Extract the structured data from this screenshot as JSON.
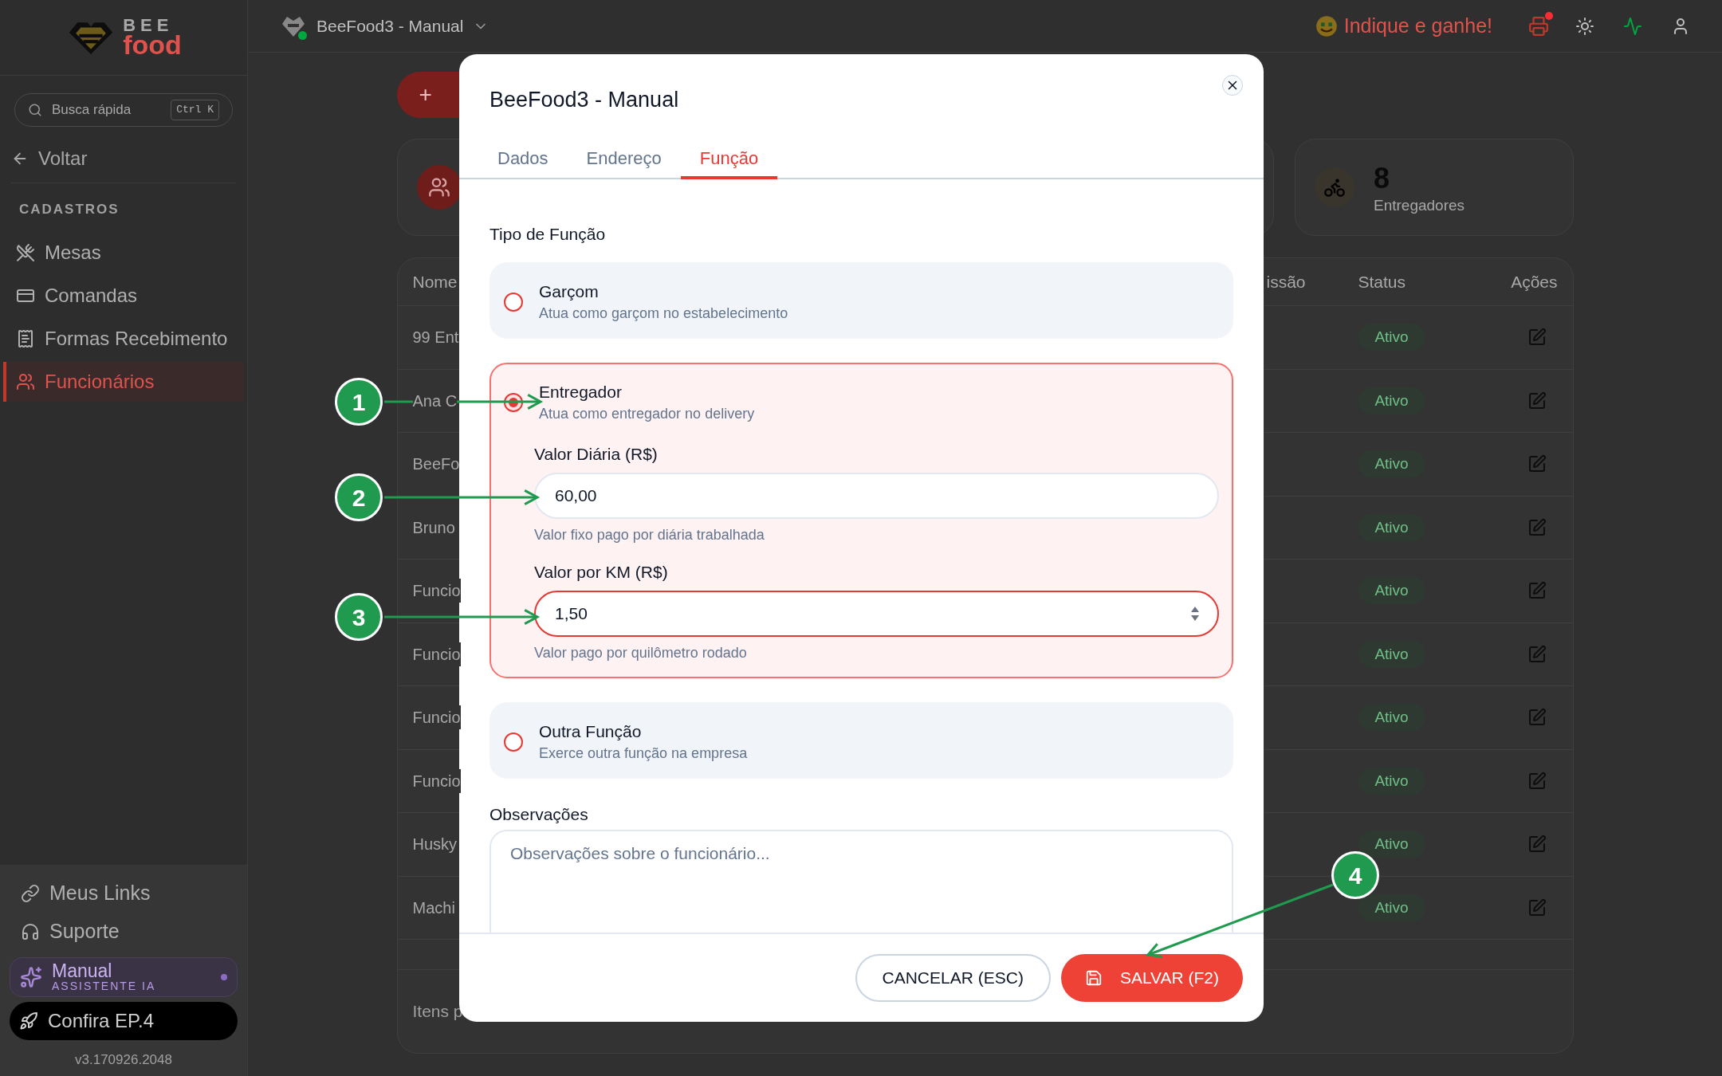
{
  "sidebar": {
    "logo_top": "BEE",
    "logo_bottom": "food",
    "search": {
      "placeholder": "Busca rápida",
      "shortcut": "Ctrl K"
    },
    "back": "Voltar",
    "section": "CADASTROS",
    "items": [
      {
        "label": "Mesas",
        "selected": false
      },
      {
        "label": "Comandas",
        "selected": false
      },
      {
        "label": "Formas Recebimento",
        "selected": false
      },
      {
        "label": "Funcionários",
        "selected": true
      }
    ],
    "footer_links": [
      "Meus Links",
      "Suporte"
    ],
    "assistant": {
      "title": "Manual",
      "subtitle": "ASSISTENTE IA"
    },
    "promo": "Confira EP.4",
    "version": "v3.170926.2048"
  },
  "topbar": {
    "workspace": "BeeFood3 - Manual",
    "referral": "Indique e ganhe!",
    "printer_alert": true
  },
  "page": {
    "add_button": "+",
    "stat_cards": [
      {
        "value": "8",
        "label": "Entregadores"
      }
    ],
    "table": {
      "columns": [
        "Nome",
        "issão",
        "Status",
        "Ações"
      ],
      "rows": [
        {
          "name": "99 Ent",
          "status": "Ativo"
        },
        {
          "name": "Ana C",
          "status": "Ativo"
        },
        {
          "name": "BeeFo",
          "status": "Ativo"
        },
        {
          "name": "Bruno",
          "status": "Ativo"
        },
        {
          "name": "Funcio",
          "status": "Ativo"
        },
        {
          "name": "Funcio",
          "status": "Ativo"
        },
        {
          "name": "Funcio",
          "status": "Ativo"
        },
        {
          "name": "Funcio",
          "status": "Ativo"
        },
        {
          "name": "Husky",
          "status": "Ativo"
        },
        {
          "name": "Machi",
          "status": "Ativo"
        }
      ]
    },
    "pagination": "Itens p"
  },
  "modal": {
    "title": "BeeFood3 - Manual",
    "tabs": [
      {
        "label": "Dados",
        "selected": false
      },
      {
        "label": "Endereço",
        "selected": false
      },
      {
        "label": "Função",
        "selected": true
      }
    ],
    "section_label": "Tipo de Função",
    "options": [
      {
        "title": "Garçom",
        "description": "Atua como garçom no estabelecimento",
        "selected": false
      },
      {
        "title": "Entregador",
        "description": "Atua como entregador no delivery",
        "selected": true,
        "fields": [
          {
            "label": "Valor Diária (R$)",
            "value": "60,00",
            "hint": "Valor fixo pago por diária trabalhada",
            "kind": "text",
            "focused": false
          },
          {
            "label": "Valor por KM (R$)",
            "value": "1,50",
            "hint": "Valor pago por quilômetro rodado",
            "kind": "number",
            "focused": true
          }
        ]
      },
      {
        "title": "Outra Função",
        "description": "Exerce outra função na empresa",
        "selected": false
      }
    ],
    "notes": {
      "label": "Observações",
      "placeholder": "Observações sobre o funcionário..."
    },
    "buttons": [
      {
        "label": "CANCELAR (ESC)",
        "kind": "secondary"
      },
      {
        "label": "SALVAR (F2)",
        "kind": "primary"
      }
    ]
  },
  "annotations": [
    {
      "number": "1"
    },
    {
      "number": "2"
    },
    {
      "number": "3"
    },
    {
      "number": "4"
    }
  ]
}
